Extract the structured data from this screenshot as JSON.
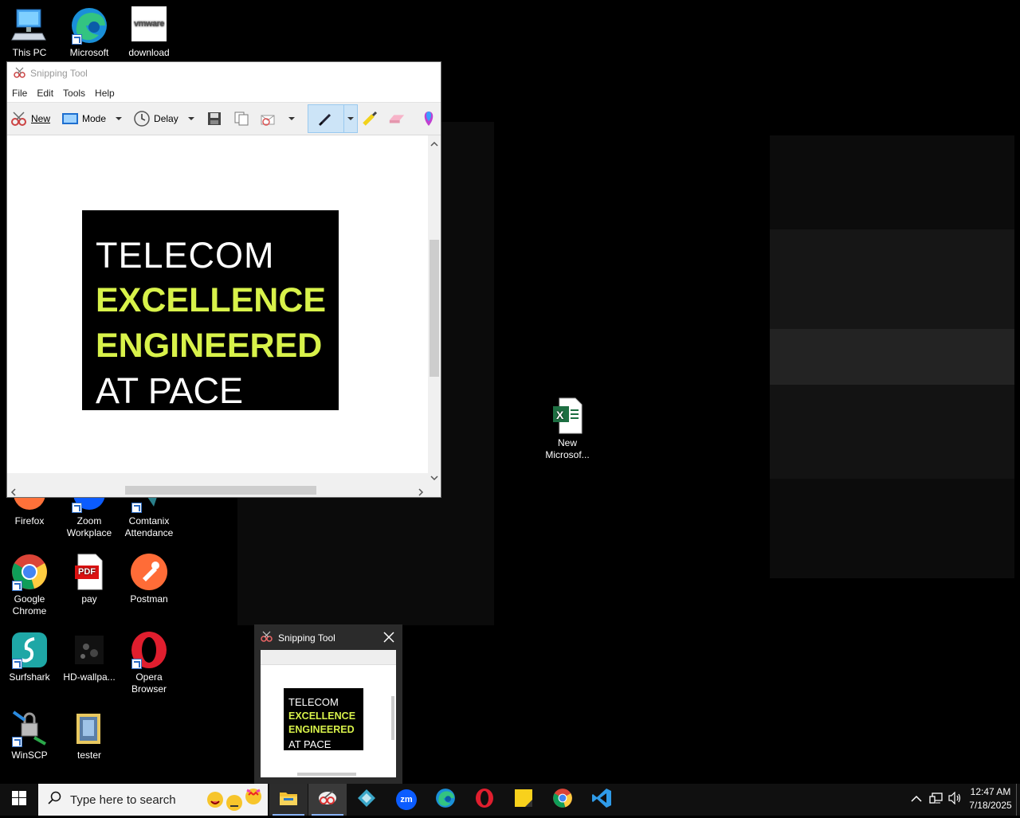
{
  "desktop": {
    "icons": [
      {
        "label": "This PC"
      },
      {
        "label": "Microsoft Edge"
      },
      {
        "label": "download"
      },
      {
        "label": "Firefox"
      },
      {
        "label": "Zoom Workplace"
      },
      {
        "label": "Comtanix Attendance"
      },
      {
        "label": "Google Chrome"
      },
      {
        "label": "pay"
      },
      {
        "label": "Postman"
      },
      {
        "label": "Surfshark"
      },
      {
        "label": "HD-wallpa..."
      },
      {
        "label": "Opera Browser"
      },
      {
        "label": "WinSCP"
      },
      {
        "label": "tester"
      },
      {
        "label": "New Microsof..."
      }
    ],
    "vmware_text": "vmware",
    "pdf_text": "PDF"
  },
  "snipping_window": {
    "title": "Snipping Tool",
    "menu": [
      "File",
      "Edit",
      "Tools",
      "Help"
    ],
    "toolbar": {
      "new_label": "New",
      "mode_label": "Mode",
      "delay_label": "Delay"
    },
    "snip_text": {
      "line1": "TELECOM",
      "line2": "EXCELLENCE",
      "line3": "ENGINEERED",
      "line4": "AT PACE"
    }
  },
  "thumbnail": {
    "title": "Snipping Tool"
  },
  "taskbar": {
    "search_placeholder": "Type here to search",
    "clock_time": "12:47 AM",
    "clock_date": "7/18/2025",
    "zoom_badge": "zm"
  },
  "colors": {
    "accent_green": "#d8f24a",
    "taskbar_bg": "#101010",
    "excel_green": "#1d6f42"
  }
}
